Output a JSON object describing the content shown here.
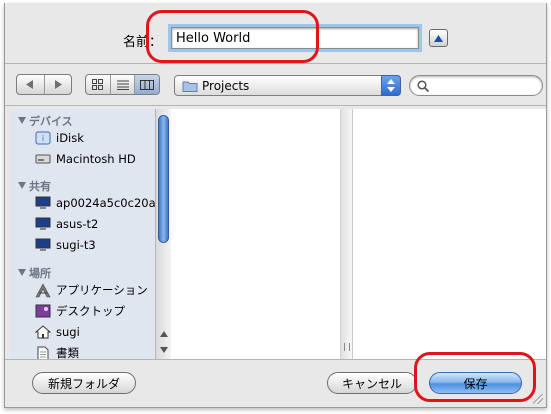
{
  "name_row": {
    "label": "名前：",
    "value": "Hello World"
  },
  "toolbar": {
    "back_icon": "chevron-left-icon",
    "forward_icon": "chevron-right-icon",
    "view_modes": [
      "icon-view",
      "list-view",
      "column-view"
    ],
    "active_view": "column-view",
    "location": "Projects",
    "search_placeholder": ""
  },
  "sidebar": {
    "sections": [
      {
        "title": "デバイス",
        "items": [
          {
            "label": "iDisk",
            "icon": "idisk-icon"
          },
          {
            "label": "Macintosh HD",
            "icon": "hard-drive-icon"
          }
        ]
      },
      {
        "title": "共有",
        "items": [
          {
            "label": "ap0024a5c0c20a",
            "icon": "computer-icon"
          },
          {
            "label": "asus-t2",
            "icon": "computer-icon"
          },
          {
            "label": "sugi-t3",
            "icon": "computer-icon"
          }
        ]
      },
      {
        "title": "場所",
        "items": [
          {
            "label": "アプリケーション",
            "icon": "applications-icon"
          },
          {
            "label": "デスクトップ",
            "icon": "desktop-icon"
          },
          {
            "label": "sugi",
            "icon": "home-icon"
          },
          {
            "label": "書類",
            "icon": "documents-icon"
          }
        ]
      }
    ]
  },
  "buttons": {
    "new_folder": "新規フォルダ",
    "cancel": "キャンセル",
    "save": "保存"
  },
  "colors": {
    "highlight_ring": "#e0141c",
    "accent": "#4e8fe0",
    "sidebar_bg": "#e0e6ef"
  }
}
